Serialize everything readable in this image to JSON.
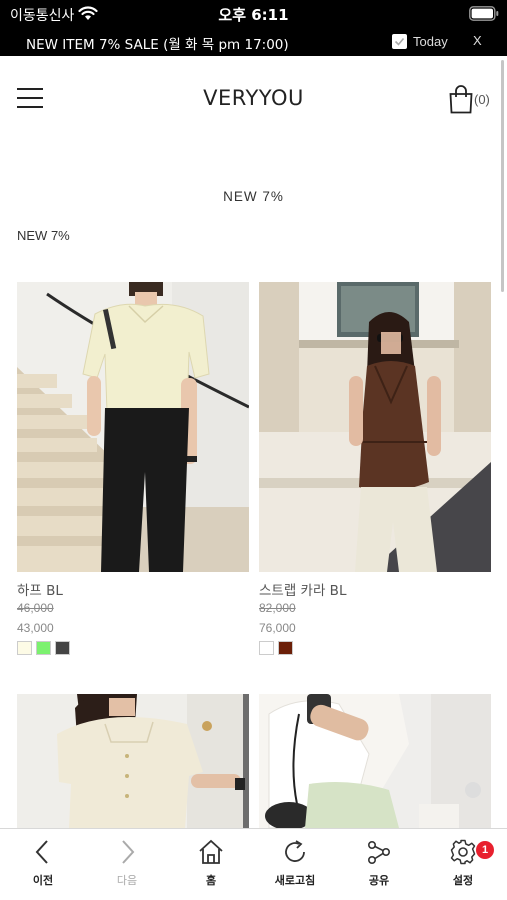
{
  "status_bar": {
    "carrier": "이동통신사",
    "time": "오후 6:11"
  },
  "promo": {
    "text": "NEW ITEM 7% SALE (월 화 목 pm 17:00)",
    "today_label": "Today",
    "close_label": "X"
  },
  "header": {
    "brand": "VERYYOU",
    "cart_count": "(0)"
  },
  "section": {
    "title": "NEW 7%",
    "category_label": "NEW 7%"
  },
  "products": [
    {
      "name": "하프 BL",
      "original_price": "46,000",
      "sale_price": "43,000",
      "swatches": [
        "#fdfbe6",
        "#7cf16f",
        "#444444"
      ]
    },
    {
      "name": "스트랩 카라 BL",
      "original_price": "82,000",
      "sale_price": "76,000",
      "swatches": [
        "#ffffff",
        "#6b1f08"
      ]
    },
    {
      "name": "",
      "original_price": "",
      "sale_price": "",
      "swatches": []
    },
    {
      "name": "",
      "original_price": "",
      "sale_price": "",
      "swatches": []
    }
  ],
  "toolbar": {
    "prev": "이전",
    "next": "다음",
    "home": "홈",
    "refresh": "새로고침",
    "share": "공유",
    "settings": "설정",
    "settings_badge": "1"
  },
  "colors": {
    "accent_badge": "#e8202e",
    "banner_bg": "#000000"
  }
}
